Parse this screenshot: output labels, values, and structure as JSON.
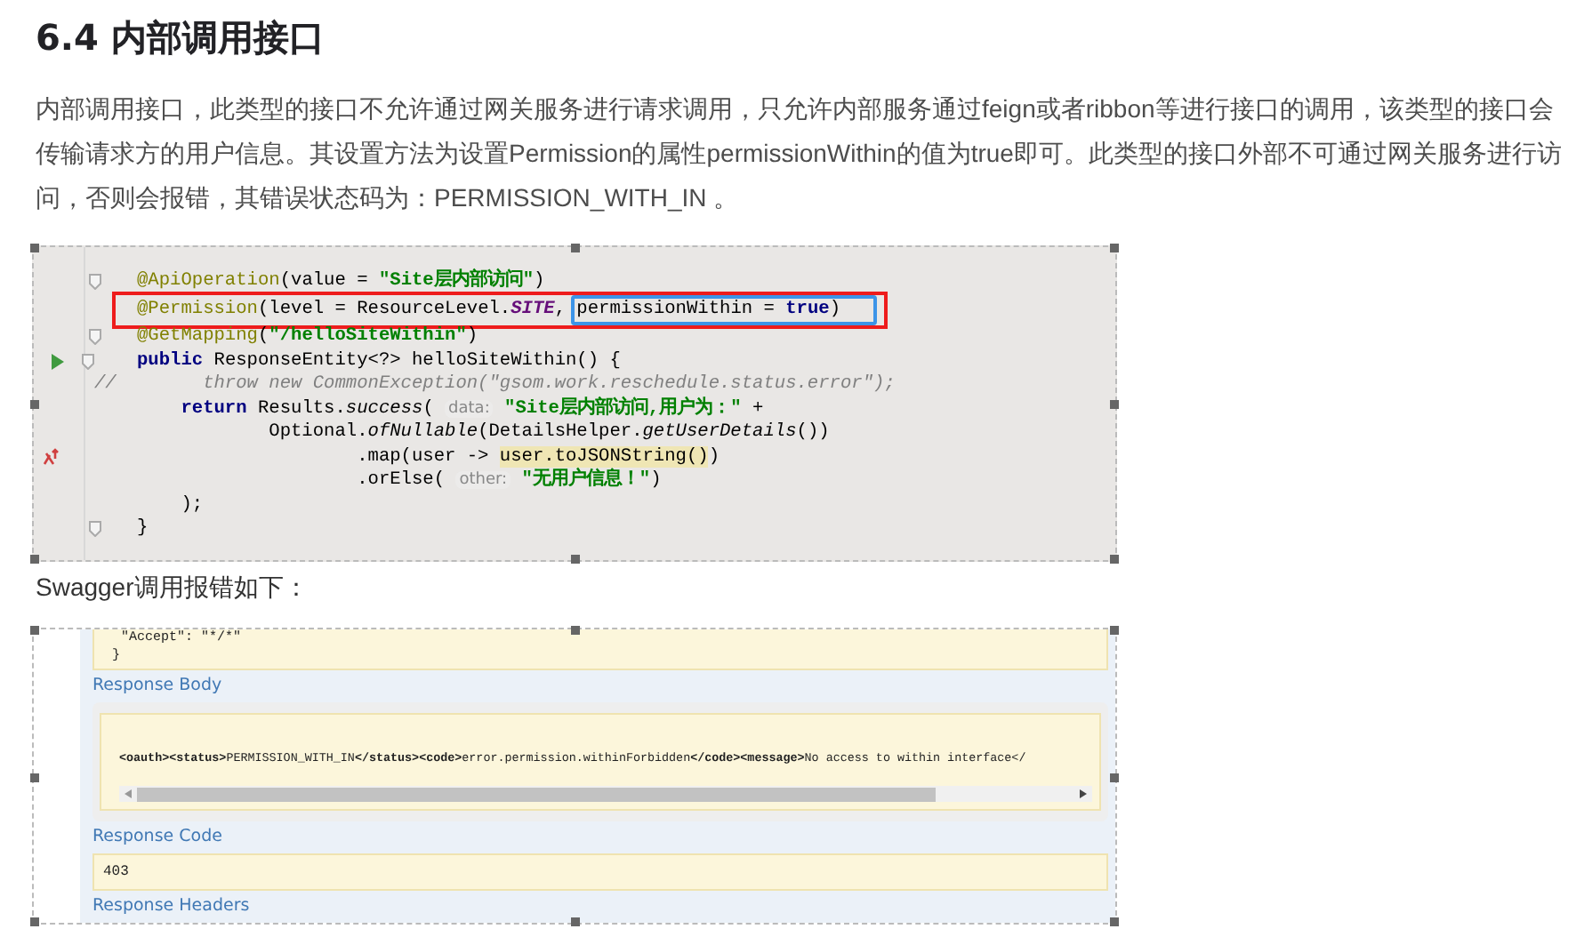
{
  "heading": "6.4 内部调用接口",
  "paragraph": "内部调用接口，此类型的接口不允许通过网关服务进行请求调用，只允许内部服务通过feign或者ribbon等进行接口的调用，该类型的接口会传输请求方的用户信息。其设置方法为设置Permission的属性permissionWithin的值为true即可。此类型的接口外部不可通过网关服务进行访问，否则会报错，其错误状态码为：PERMISSION_WITH_IN 。",
  "code_screenshot": {
    "lines": [
      {
        "kind": "fold",
        "tokens": [
          {
            "kind": "annotation",
            "text": "@ApiOperation"
          },
          {
            "kind": "plain",
            "text": "(value = "
          },
          {
            "kind": "string",
            "text": "\"Site层内部访问\""
          },
          {
            "kind": "plain",
            "text": ")"
          }
        ]
      },
      {
        "kind": "plain",
        "highlight": true,
        "tokens": [
          {
            "kind": "annotation",
            "text": "@Permission"
          },
          {
            "kind": "plain",
            "text": "(level = ResourceLevel."
          },
          {
            "kind": "constant",
            "text": "SITE"
          },
          {
            "kind": "plain",
            "text": ", permissionWithin = "
          },
          {
            "kind": "keyword",
            "text": "true"
          },
          {
            "kind": "plain",
            "text": ")"
          }
        ]
      },
      {
        "kind": "fold",
        "tokens": [
          {
            "kind": "annotation",
            "text": "@GetMapping"
          },
          {
            "kind": "plain",
            "text": "("
          },
          {
            "kind": "string",
            "text": "\"/helloSiteWithin\""
          },
          {
            "kind": "plain",
            "text": ")"
          }
        ]
      },
      {
        "kind": "run",
        "tokens": [
          {
            "kind": "keyword",
            "text": "public "
          },
          {
            "kind": "plain",
            "text": "ResponseEntity<?> helloSiteWithin() {"
          }
        ]
      },
      {
        "kind": "comment",
        "comment_mark": "//",
        "tokens": [
          {
            "kind": "comment",
            "text": "      throw new CommonException(\"gsom.work.reschedule.status.error\");"
          }
        ]
      },
      {
        "kind": "plain",
        "tokens": [
          {
            "kind": "keyword",
            "text": "    return "
          },
          {
            "kind": "plain",
            "text": "Results."
          },
          {
            "kind": "method",
            "text": "success"
          },
          {
            "kind": "plain",
            "text": "( "
          },
          {
            "kind": "hint",
            "text": "data:"
          },
          {
            "kind": "string",
            "text": " \"Site层内部访问,用户为：\""
          },
          {
            "kind": "plain",
            "text": " +"
          }
        ]
      },
      {
        "kind": "plain",
        "tokens": [
          {
            "kind": "plain",
            "text": "            Optional."
          },
          {
            "kind": "method",
            "text": "ofNullable"
          },
          {
            "kind": "plain",
            "text": "(DetailsHelper."
          },
          {
            "kind": "method",
            "text": "getUserDetails"
          },
          {
            "kind": "plain",
            "text": "())"
          }
        ]
      },
      {
        "kind": "lambda",
        "tokens": [
          {
            "kind": "plain",
            "text": "                    .map(user -> "
          },
          {
            "kind": "marked",
            "text": "user.toJSONString()"
          },
          {
            "kind": "plain",
            "text": ")"
          }
        ]
      },
      {
        "kind": "plain",
        "tokens": [
          {
            "kind": "plain",
            "text": "                    .orElse( "
          },
          {
            "kind": "hint",
            "text": "other:"
          },
          {
            "kind": "string",
            "text": " \"无用户信息！\""
          },
          {
            "kind": "plain",
            "text": ")"
          }
        ]
      },
      {
        "kind": "plain",
        "tokens": [
          {
            "kind": "plain",
            "text": "    );"
          }
        ]
      },
      {
        "kind": "fold",
        "tokens": [
          {
            "kind": "plain",
            "text": "}"
          }
        ]
      }
    ]
  },
  "caption": "Swagger调用报错如下：",
  "swagger_screenshot": {
    "request_tail": [
      "\"Accept\": \"*/*\"",
      "}"
    ],
    "sections": [
      {
        "kind": "body",
        "title": "Response Body",
        "value": "**<oauth><status>**PERMISSION_WITH_IN**</status><code>**error.permission.withinForbidden**</code><message>**No access to within interface</"
      },
      {
        "kind": "code",
        "title": "Response Code",
        "value": "403"
      },
      {
        "kind": "headers",
        "title": "Response Headers"
      }
    ]
  }
}
